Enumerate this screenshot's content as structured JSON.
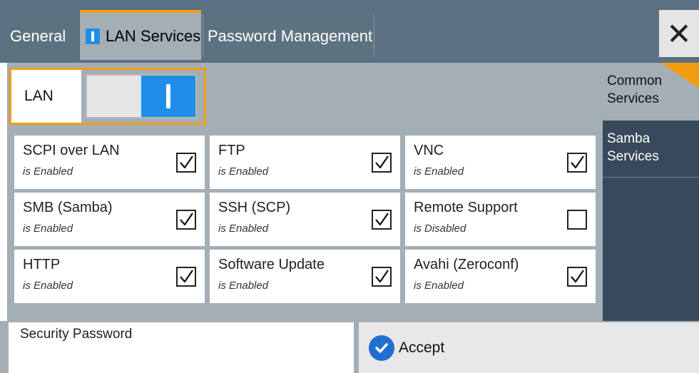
{
  "tabs": {
    "general": "General",
    "lan_services": "LAN Services",
    "password_management": "Password Management"
  },
  "close_icon": "close-icon",
  "lan": {
    "label": "LAN",
    "enabled": true
  },
  "services": [
    {
      "name": "SCPI over LAN",
      "status": "is Enabled",
      "checked": true
    },
    {
      "name": "FTP",
      "status": "is Enabled",
      "checked": true
    },
    {
      "name": "VNC",
      "status": "is Enabled",
      "checked": true
    },
    {
      "name": "SMB (Samba)",
      "status": "is Enabled",
      "checked": true
    },
    {
      "name": "SSH (SCP)",
      "status": "is Enabled",
      "checked": true
    },
    {
      "name": "Remote Support",
      "status": "is Disabled",
      "checked": false
    },
    {
      "name": "HTTP",
      "status": "is Enabled",
      "checked": true
    },
    {
      "name": "Software Update",
      "status": "is Enabled",
      "checked": true
    },
    {
      "name": "Avahi (Zeroconf)",
      "status": "is Enabled",
      "checked": true
    }
  ],
  "side": {
    "common_services": "Common Services",
    "samba_services": "Samba Services"
  },
  "security_password": {
    "label": "Security Password",
    "value": ""
  },
  "accept": {
    "label": "Accept"
  },
  "colors": {
    "accent_orange": "#f39c12",
    "accent_blue": "#1f8ee8",
    "panel_gray": "#a4aeb5",
    "header_slate": "#5b7080",
    "side_dark": "#37495a"
  }
}
